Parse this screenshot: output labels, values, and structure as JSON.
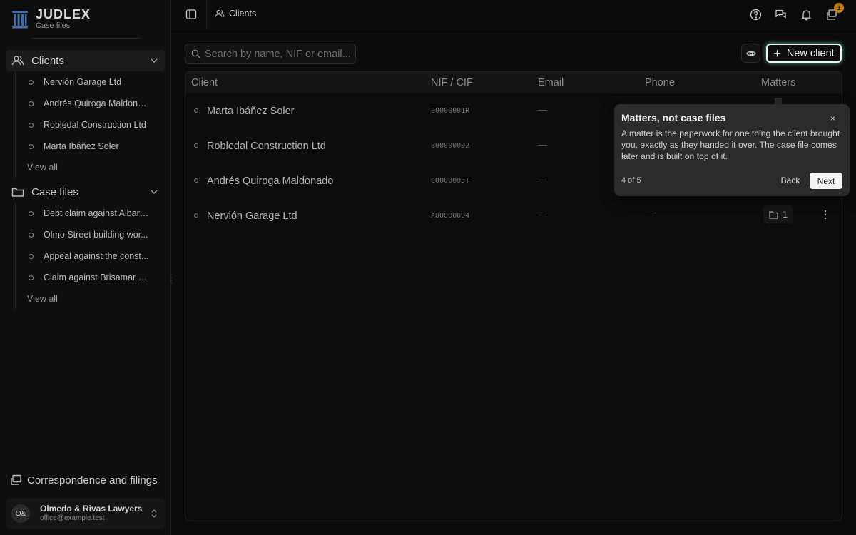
{
  "app": {
    "title": "JUDLEX",
    "subtitle": "Case files"
  },
  "sidebar": {
    "clients": {
      "label": "Clients",
      "items": [
        "Nervión Garage Ltd",
        "Andrés Quiroga Maldona...",
        "Robledal Construction Ltd",
        "Marta Ibáñez Soler"
      ],
      "view_all": "View all"
    },
    "case_files": {
      "label": "Case files",
      "items": [
        "Debt claim against Albarr...",
        "Olmo Street building wor...",
        "Appeal against the const...",
        "Claim against Brisamar In..."
      ],
      "view_all": "View all"
    },
    "correspondence": "Correspondence and filings",
    "account": {
      "initials": "O&",
      "name": "Olmedo & Rivas Lawyers",
      "email": "office@example.test"
    }
  },
  "header": {
    "breadcrumb": "Clients",
    "notification_count": "1"
  },
  "toolbar": {
    "search_placeholder": "Search by name, NIF or email...",
    "new_client_label": "New client"
  },
  "table": {
    "columns": [
      "Client",
      "NIF / CIF",
      "Email",
      "Phone",
      "Matters"
    ],
    "rows": [
      {
        "client": "Marta Ibáñez Soler",
        "nif": "00000001R",
        "email": "—",
        "phone": "",
        "matters": ""
      },
      {
        "client": "Robledal Construction Ltd",
        "nif": "B00000002",
        "email": "—",
        "phone": "",
        "matters": ""
      },
      {
        "client": "Andrés Quiroga Maldonado",
        "nif": "00000003T",
        "email": "—",
        "phone": "",
        "matters": ""
      },
      {
        "client": "Nervión Garage Ltd",
        "nif": "A00000004",
        "email": "—",
        "phone": "—",
        "matters": "1"
      }
    ]
  },
  "tour": {
    "title": "Matters, not case files",
    "body": "A matter is the paperwork for one thing the client brought you, exactly as they handed it over. The case file comes later and is built on top of it.",
    "step": "4 of 5",
    "close": "×",
    "back": "Back",
    "next": "Next"
  },
  "colors": {
    "accent_badge": "#c77d11",
    "glow": "#78dcc8"
  }
}
